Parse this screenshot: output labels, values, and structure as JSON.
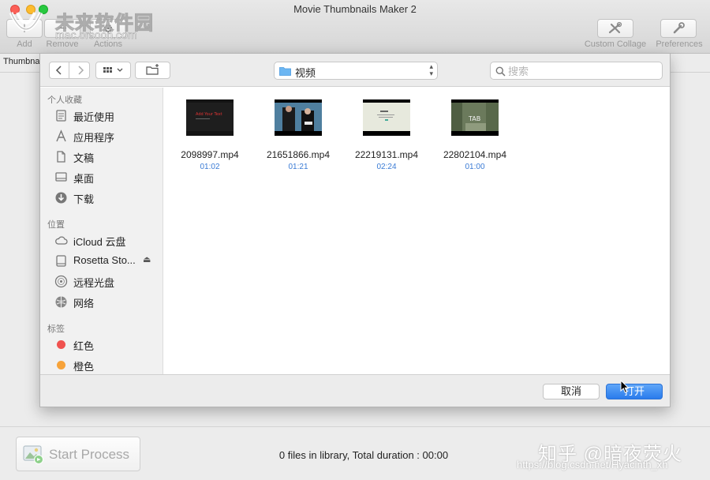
{
  "window": {
    "title": "Movie Thumbnails Maker 2",
    "toolbar": {
      "add_label": "Add",
      "remove_label": "Remove",
      "actions_label": "Actions",
      "custom_collage_label": "Custom Collage",
      "preferences_label": "Preferences"
    },
    "sub_label": "Thumbna"
  },
  "watermark": {
    "site_name": "未来软件园",
    "site_url": "mac.orsoon.com"
  },
  "dialog": {
    "path": "视频",
    "search_placeholder": "搜索",
    "sidebar": {
      "favorites_header": "个人收藏",
      "favorites": [
        {
          "label": "最近使用",
          "icon": "recents-icon"
        },
        {
          "label": "应用程序",
          "icon": "applications-icon"
        },
        {
          "label": "文稿",
          "icon": "documents-icon"
        },
        {
          "label": "桌面",
          "icon": "desktop-icon"
        },
        {
          "label": "下载",
          "icon": "downloads-icon"
        }
      ],
      "locations_header": "位置",
      "locations": [
        {
          "label": "iCloud 云盘",
          "icon": "icloud-icon"
        },
        {
          "label": "Rosetta Sto...",
          "icon": "disk-icon"
        },
        {
          "label": "远程光盘",
          "icon": "remote-disc-icon"
        },
        {
          "label": "网络",
          "icon": "network-icon"
        }
      ],
      "tags_header": "标签",
      "tags": [
        {
          "label": "红色",
          "color": "#f0524f"
        },
        {
          "label": "橙色",
          "color": "#f7a33a"
        }
      ]
    },
    "files": [
      {
        "name": "2098997.mp4",
        "duration": "01:02",
        "thumb_text": "Add Your Text"
      },
      {
        "name": "21651866.mp4",
        "duration": "01:21"
      },
      {
        "name": "22219131.mp4",
        "duration": "02:24"
      },
      {
        "name": "22802104.mp4",
        "duration": "01:00",
        "thumb_text": "TAB"
      }
    ],
    "cancel_label": "取消",
    "open_label": "打开"
  },
  "bottom": {
    "start_label": "Start Process",
    "status": "0 files in library, Total duration : 00:00",
    "zhihu_watermark": "知乎 @暗夜荧火",
    "csdn_watermark": "https://blog.csdn.net/Hyacinth_xh"
  },
  "colors": {
    "accent": "#2a7bec",
    "duration_text": "#3a7bd5",
    "tag_red": "#f0524f",
    "tag_orange": "#f7a33a"
  }
}
